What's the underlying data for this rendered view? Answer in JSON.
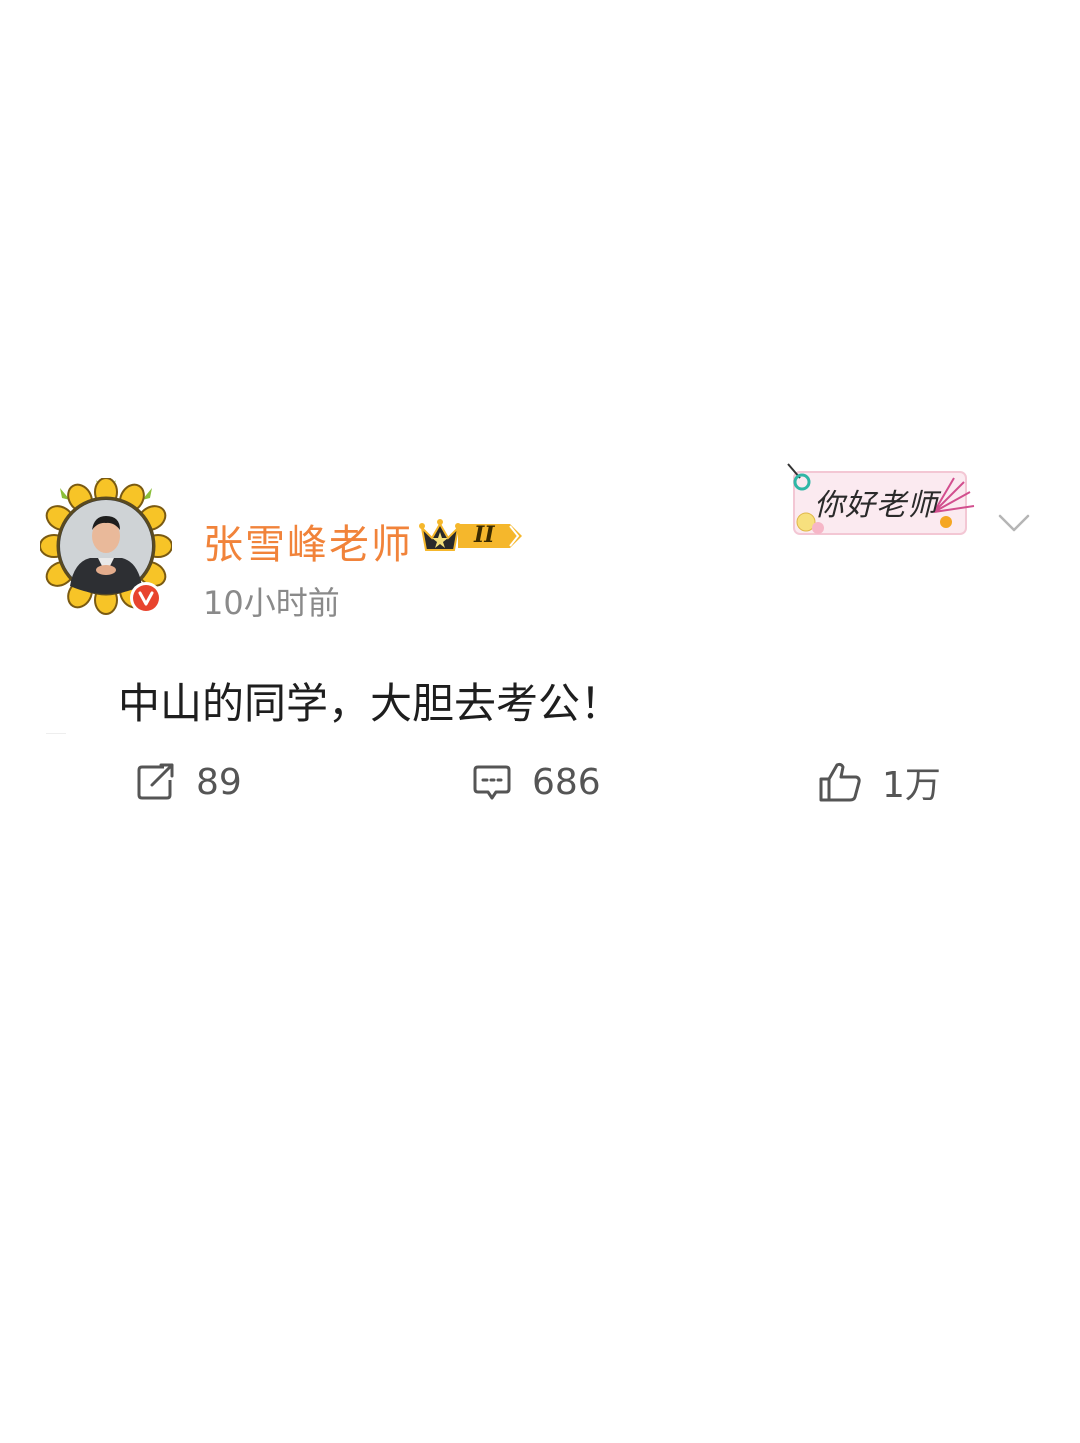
{
  "post": {
    "author": {
      "name": "张雪峰老师",
      "verified_icon": "verified-v-icon",
      "member_badge_level": "II"
    },
    "timestamp": "10小时前",
    "sticker_text": "你好老师",
    "content": "中山的同学，大胆去考公！",
    "actions": {
      "repost_count": "89",
      "comment_count": "686",
      "like_count": "1万"
    }
  },
  "colors": {
    "username": "#f1833a",
    "timestamp": "#8a8a8a",
    "text": "#1e1e1e",
    "action_icon": "#555555",
    "badge_gold": "#f5b72c",
    "verified_red": "#e8442e"
  },
  "icons": [
    "sunflower-avatar-frame",
    "verified-v-icon",
    "crown-icon",
    "chevron-down-icon",
    "repost-icon",
    "comment-icon",
    "like-icon"
  ]
}
